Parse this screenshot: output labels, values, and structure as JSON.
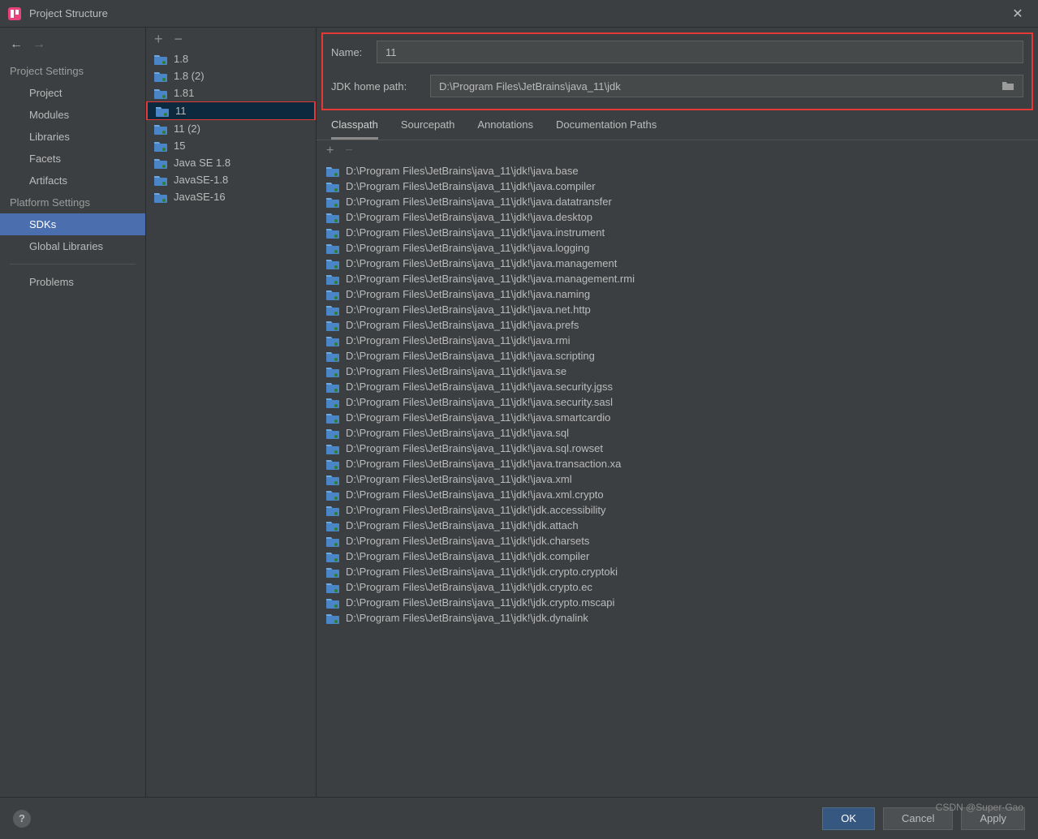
{
  "window": {
    "title": "Project Structure"
  },
  "sidebar": {
    "sections": {
      "project_settings": {
        "header": "Project Settings",
        "items": [
          {
            "label": "Project"
          },
          {
            "label": "Modules"
          },
          {
            "label": "Libraries"
          },
          {
            "label": "Facets"
          },
          {
            "label": "Artifacts"
          }
        ]
      },
      "platform_settings": {
        "header": "Platform Settings",
        "items": [
          {
            "label": "SDKs",
            "selected": true
          },
          {
            "label": "Global Libraries"
          }
        ]
      },
      "problems": {
        "label": "Problems"
      }
    }
  },
  "sdk_list": [
    {
      "label": "1.8"
    },
    {
      "label": "1.8 (2)"
    },
    {
      "label": "1.81"
    },
    {
      "label": "11",
      "selected": true
    },
    {
      "label": "11 (2)"
    },
    {
      "label": "15"
    },
    {
      "label": "Java SE 1.8"
    },
    {
      "label": "JavaSE-1.8"
    },
    {
      "label": "JavaSE-16"
    }
  ],
  "form": {
    "name_label": "Name:",
    "name_value": "11",
    "jdk_home_label": "JDK home path:",
    "jdk_home_value": "D:\\Program Files\\JetBrains\\java_11\\jdk"
  },
  "tabs": [
    {
      "label": "Classpath",
      "active": true
    },
    {
      "label": "Sourcepath"
    },
    {
      "label": "Annotations"
    },
    {
      "label": "Documentation Paths"
    }
  ],
  "classpath": [
    "D:\\Program Files\\JetBrains\\java_11\\jdk!\\java.base",
    "D:\\Program Files\\JetBrains\\java_11\\jdk!\\java.compiler",
    "D:\\Program Files\\JetBrains\\java_11\\jdk!\\java.datatransfer",
    "D:\\Program Files\\JetBrains\\java_11\\jdk!\\java.desktop",
    "D:\\Program Files\\JetBrains\\java_11\\jdk!\\java.instrument",
    "D:\\Program Files\\JetBrains\\java_11\\jdk!\\java.logging",
    "D:\\Program Files\\JetBrains\\java_11\\jdk!\\java.management",
    "D:\\Program Files\\JetBrains\\java_11\\jdk!\\java.management.rmi",
    "D:\\Program Files\\JetBrains\\java_11\\jdk!\\java.naming",
    "D:\\Program Files\\JetBrains\\java_11\\jdk!\\java.net.http",
    "D:\\Program Files\\JetBrains\\java_11\\jdk!\\java.prefs",
    "D:\\Program Files\\JetBrains\\java_11\\jdk!\\java.rmi",
    "D:\\Program Files\\JetBrains\\java_11\\jdk!\\java.scripting",
    "D:\\Program Files\\JetBrains\\java_11\\jdk!\\java.se",
    "D:\\Program Files\\JetBrains\\java_11\\jdk!\\java.security.jgss",
    "D:\\Program Files\\JetBrains\\java_11\\jdk!\\java.security.sasl",
    "D:\\Program Files\\JetBrains\\java_11\\jdk!\\java.smartcardio",
    "D:\\Program Files\\JetBrains\\java_11\\jdk!\\java.sql",
    "D:\\Program Files\\JetBrains\\java_11\\jdk!\\java.sql.rowset",
    "D:\\Program Files\\JetBrains\\java_11\\jdk!\\java.transaction.xa",
    "D:\\Program Files\\JetBrains\\java_11\\jdk!\\java.xml",
    "D:\\Program Files\\JetBrains\\java_11\\jdk!\\java.xml.crypto",
    "D:\\Program Files\\JetBrains\\java_11\\jdk!\\jdk.accessibility",
    "D:\\Program Files\\JetBrains\\java_11\\jdk!\\jdk.attach",
    "D:\\Program Files\\JetBrains\\java_11\\jdk!\\jdk.charsets",
    "D:\\Program Files\\JetBrains\\java_11\\jdk!\\jdk.compiler",
    "D:\\Program Files\\JetBrains\\java_11\\jdk!\\jdk.crypto.cryptoki",
    "D:\\Program Files\\JetBrains\\java_11\\jdk!\\jdk.crypto.ec",
    "D:\\Program Files\\JetBrains\\java_11\\jdk!\\jdk.crypto.mscapi",
    "D:\\Program Files\\JetBrains\\java_11\\jdk!\\jdk.dynalink"
  ],
  "footer": {
    "ok": "OK",
    "cancel": "Cancel",
    "apply": "Apply",
    "watermark": "CSDN @Super·Gao"
  }
}
